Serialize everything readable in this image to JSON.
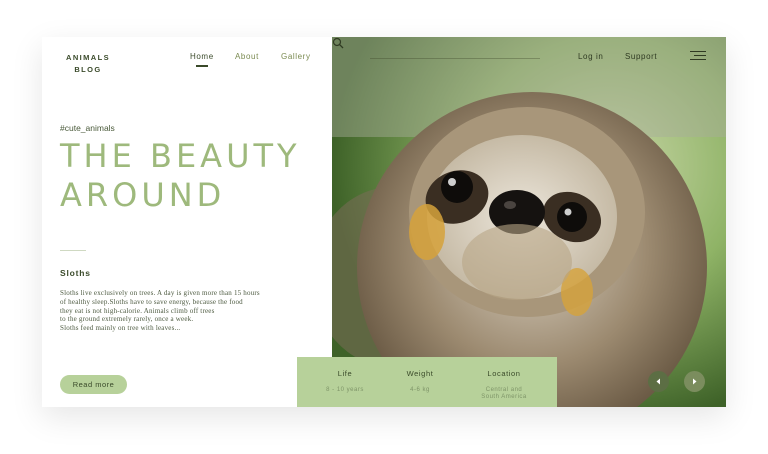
{
  "brand": {
    "line1": "ANIMALS",
    "line2": "BLOG"
  },
  "nav": {
    "items": [
      {
        "label": "Home",
        "active": true
      },
      {
        "label": "About",
        "active": false
      },
      {
        "label": "Gallery",
        "active": false
      }
    ]
  },
  "top_links": {
    "login": "Log in",
    "support": "Support"
  },
  "hero": {
    "hashtag": "#cute_animals",
    "headline_line1": "THE BEAUTY",
    "headline_line2": "AROUND",
    "subtitle": "Sloths",
    "body_lines": [
      "Sloths live exclusively on trees. A day is given more than 15 hours",
      "of healthy sleep.Sloths have to save energy, because the food",
      "they eat is not high-calorie. Animals climb off trees",
      "to the ground extremely rarely, once a week.",
      "Sloths feed mainly on tree with leaves..."
    ],
    "cta_label": "Read more"
  },
  "info": {
    "life": {
      "label": "Life",
      "value": "8 - 10 years"
    },
    "weight": {
      "label": "Weight",
      "value": "4-6 kg"
    },
    "location": {
      "label": "Location",
      "value_line1": "Central and",
      "value_line2": "South America"
    }
  },
  "icons": {
    "search": "search-icon",
    "menu": "hamburger-menu-icon",
    "prev": "chevron-left-icon",
    "next": "chevron-right-icon"
  },
  "colors": {
    "accent_green": "#9eb97c",
    "panel_green": "#b7d19a",
    "dark_text": "#3a4a2a"
  }
}
